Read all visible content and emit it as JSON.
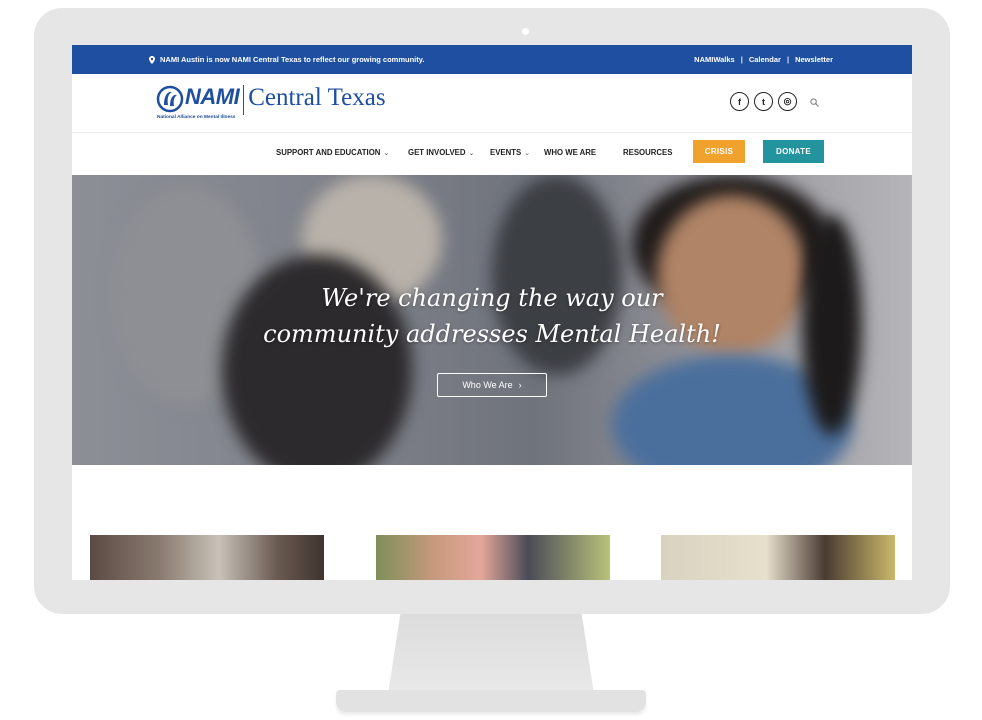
{
  "topbar": {
    "notice": "NAMI Austin is now NAMI Central Texas to reflect our growing community.",
    "links": [
      "NAMIWalks",
      "Calendar",
      "Newsletter"
    ],
    "separator": "|"
  },
  "logo": {
    "nami": "NAMI",
    "name": "Central Texas",
    "subtitle": "National Alliance on Mental Illness"
  },
  "socials": [
    {
      "icon": "facebook-icon",
      "glyph": "f"
    },
    {
      "icon": "twitter-icon",
      "glyph": "t"
    },
    {
      "icon": "instagram-icon",
      "glyph": "◎"
    }
  ],
  "nav": {
    "items": [
      {
        "label": "SUPPORT AND EDUCATION",
        "has_dropdown": true
      },
      {
        "label": "GET INVOLVED",
        "has_dropdown": true
      },
      {
        "label": "EVENTS",
        "has_dropdown": true
      },
      {
        "label": "WHO WE ARE",
        "has_dropdown": false
      },
      {
        "label": "RESOURCES",
        "has_dropdown": false
      }
    ],
    "crisis_label": "CRISIS",
    "donate_label": "DONATE",
    "chevron": "⌄"
  },
  "hero": {
    "line1": "We're changing the way our",
    "line2": "community addresses Mental Health!",
    "button_label": "Who We Are",
    "button_arrow": "›"
  },
  "colors": {
    "brand_blue": "#1f4fa0",
    "crisis": "#f0a22c",
    "donate": "#23949e"
  }
}
